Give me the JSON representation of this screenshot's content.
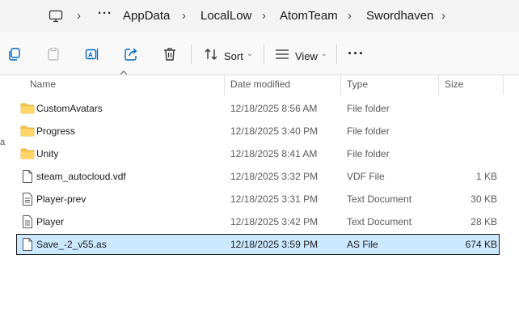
{
  "breadcrumb": {
    "more": "···",
    "items": [
      "AppData",
      "LocalLow",
      "AtomTeam",
      "Swordhaven"
    ]
  },
  "toolbar": {
    "sort_label": "Sort",
    "view_label": "View",
    "more": "···"
  },
  "columns": {
    "name": "Name",
    "date": "Date modified",
    "type": "Type",
    "size": "Size"
  },
  "files": [
    {
      "name": "CustomAvatars",
      "date": "12/18/2025 8:56 AM",
      "type": "File folder",
      "size": "",
      "icon": "folder-icon"
    },
    {
      "name": "Progress",
      "date": "12/18/2025 3:40 PM",
      "type": "File folder",
      "size": "",
      "icon": "folder-icon"
    },
    {
      "name": "Unity",
      "date": "12/18/2025 8:41 AM",
      "type": "File folder",
      "size": "",
      "icon": "folder-icon"
    },
    {
      "name": "steam_autocloud.vdf",
      "date": "12/18/2025 3:32 PM",
      "type": "VDF File",
      "size": "1 KB",
      "icon": "file-icon"
    },
    {
      "name": "Player-prev",
      "date": "12/18/2025 3:31 PM",
      "type": "Text Document",
      "size": "30 KB",
      "icon": "text-file-icon"
    },
    {
      "name": "Player",
      "date": "12/18/2025 3:42 PM",
      "type": "Text Document",
      "size": "28 KB",
      "icon": "text-file-icon"
    },
    {
      "name": "Save_-2_v55.as",
      "date": "12/18/2025 3:59 PM",
      "type": "AS File",
      "size": "674 KB",
      "icon": "file-icon"
    }
  ],
  "selected_index": 6,
  "left_edge_text": "a",
  "colors": {
    "folder": "#f7c548",
    "selection_bg": "#cce8ff",
    "accent": "#0067c0"
  }
}
